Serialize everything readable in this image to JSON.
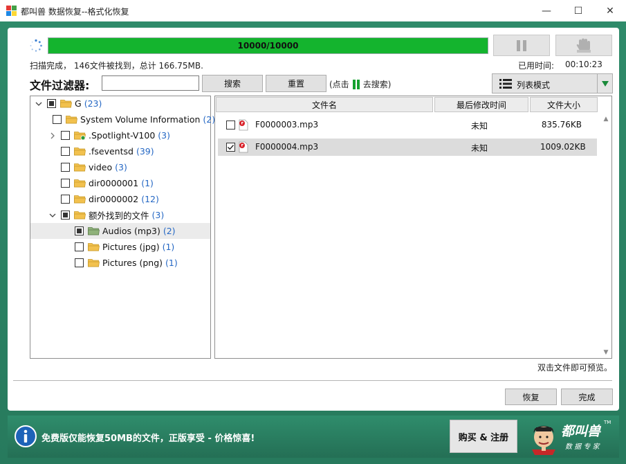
{
  "window": {
    "title": "都叫兽 数据恢复--格式化恢复",
    "minimize": "—",
    "maximize": "☐",
    "close": "✕"
  },
  "progress": {
    "text": "10000/10000",
    "fraction": 1.0
  },
  "status": {
    "summary": "扫描完成， 146文件被找到，总计 166.75MB.",
    "time_label": "已用时间:",
    "time_value": "00:10:23"
  },
  "filter": {
    "label": "文件过滤器:",
    "input_value": "",
    "search_label": "搜索",
    "reset_label": "重置",
    "hint_prefix": "(点击",
    "hint_suffix": "去搜索)"
  },
  "view_mode": {
    "label": "列表模式"
  },
  "tree": [
    {
      "label": "G",
      "count": "(23)",
      "indent": 0,
      "expander": "collapse",
      "check": "partial",
      "folder": "open",
      "selected": false
    },
    {
      "label": "System Volume Information",
      "count": "(2)",
      "indent": 1,
      "expander": "",
      "check": "none",
      "folder": "open",
      "selected": false
    },
    {
      "label": ".Spotlight-V100",
      "count": "(3)",
      "indent": 1,
      "expander": "expand",
      "check": "none",
      "folder": "special",
      "selected": false
    },
    {
      "label": ".fseventsd",
      "count": "(39)",
      "indent": 1,
      "expander": "",
      "check": "none",
      "folder": "open",
      "selected": false
    },
    {
      "label": "video",
      "count": "(3)",
      "indent": 1,
      "expander": "",
      "check": "none",
      "folder": "open",
      "selected": false
    },
    {
      "label": "dir0000001",
      "count": "(1)",
      "indent": 1,
      "expander": "",
      "check": "none",
      "folder": "open",
      "selected": false
    },
    {
      "label": "dir0000002",
      "count": "(12)",
      "indent": 1,
      "expander": "",
      "check": "none",
      "folder": "open",
      "selected": false
    },
    {
      "label": "额外找到的文件",
      "count": "(3)",
      "indent": 1,
      "expander": "collapse",
      "check": "partial",
      "folder": "open",
      "selected": false
    },
    {
      "label": "Audios (mp3)",
      "count": "(2)",
      "indent": 2,
      "expander": "",
      "check": "partial",
      "folder": "green",
      "selected": true
    },
    {
      "label": "Pictures (jpg)",
      "count": "(1)",
      "indent": 2,
      "expander": "",
      "check": "none",
      "folder": "open",
      "selected": false
    },
    {
      "label": "Pictures (png)",
      "count": "(1)",
      "indent": 2,
      "expander": "",
      "check": "none",
      "folder": "open",
      "selected": false
    }
  ],
  "file_table": {
    "headers": {
      "name": "文件名",
      "modified": "最后修改时间",
      "size": "文件大小"
    },
    "rows": [
      {
        "name": "F0000003.mp3",
        "modified": "未知",
        "size": "835.76KB",
        "checked": false,
        "selected": false
      },
      {
        "name": "F0000004.mp3",
        "modified": "未知",
        "size": "1009.02KB",
        "checked": true,
        "selected": true
      }
    ]
  },
  "preview_hint": "双击文件即可预览。",
  "buttons": {
    "recover": "恢复",
    "finish": "完成"
  },
  "promo": {
    "text": "免费版仅能恢复50MB的文件，正版享受 - 价格惊喜!",
    "buy_label": "购买 & 注册"
  },
  "logo": {
    "brand": "都叫兽",
    "tagline": "数 据 专 家",
    "tm": "TM"
  },
  "colors": {
    "frame_green": "#2d8467",
    "progress_green": "#14b42e",
    "count_blue": "#2467c4",
    "folder_yellow": "#f2c14e",
    "folder_green": "#8fb27a"
  }
}
